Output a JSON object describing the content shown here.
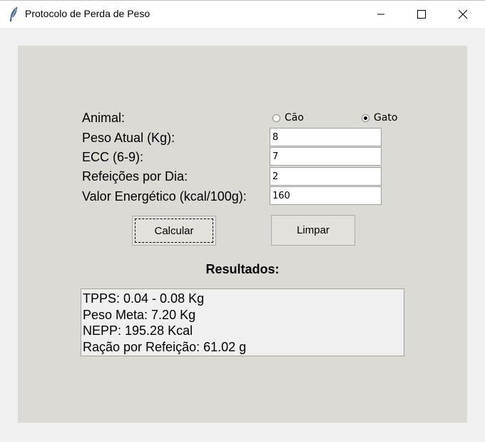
{
  "window": {
    "title": "Protocolo de Perda de Peso",
    "icon": "feather-icon"
  },
  "form": {
    "animal_label": "Animal:",
    "animal_options": [
      {
        "label": "Cão",
        "checked": false
      },
      {
        "label": "Gato",
        "checked": true
      }
    ],
    "peso_label": "Peso Atual (Kg):",
    "peso_value": "8",
    "ecc_label": "ECC (6-9):",
    "ecc_value": "7",
    "refeicoes_label": "Refeições por Dia:",
    "refeicoes_value": "2",
    "energia_label": "Valor Energético (kcal/100g):",
    "energia_value": "160"
  },
  "buttons": {
    "calcular": "Calcular",
    "limpar": "Limpar"
  },
  "results": {
    "title": "Resultados:",
    "lines": [
      "TPPS: 0.04 - 0.08 Kg",
      "Peso Meta: 7.20 Kg",
      "NEPP: 195.28 Kcal",
      "Ração por Refeição: 61.02 g"
    ]
  },
  "colors": {
    "panel_bg": "#dcdad5",
    "window_bg": "#f0f0f0",
    "titlebar_bg": "#ffffff"
  }
}
